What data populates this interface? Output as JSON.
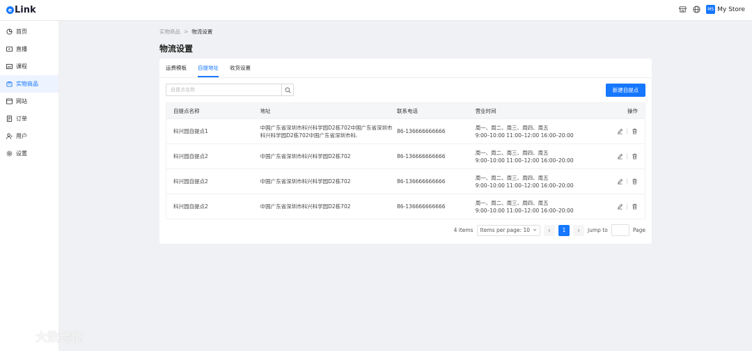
{
  "app": {
    "logo_text": "Link",
    "logo_mark": "e"
  },
  "header": {
    "store_badge": "MS",
    "store_name": "My Store",
    "icons": [
      "storefront-icon",
      "globe-icon"
    ]
  },
  "sidebar": {
    "items": [
      {
        "label": "首页",
        "icon": "dashboard-icon",
        "active": false
      },
      {
        "label": "直播",
        "icon": "live-icon",
        "active": false
      },
      {
        "label": "课程",
        "icon": "course-icon",
        "active": false
      },
      {
        "label": "实物商品",
        "icon": "product-icon",
        "active": true
      },
      {
        "label": "网站",
        "icon": "website-icon",
        "active": false
      },
      {
        "label": "订单",
        "icon": "order-icon",
        "active": false
      },
      {
        "label": "用户",
        "icon": "user-icon",
        "active": false
      },
      {
        "label": "设置",
        "icon": "settings-icon",
        "active": false
      }
    ]
  },
  "breadcrumb": {
    "parent": "实物商品",
    "separator": ">",
    "current": "物流设置"
  },
  "page": {
    "title": "物流设置"
  },
  "tabs": [
    {
      "label": "运费模板",
      "active": false
    },
    {
      "label": "自提地址",
      "active": true
    },
    {
      "label": "收货设置",
      "active": false
    }
  ],
  "search": {
    "placeholder": "自提点名称",
    "value": ""
  },
  "new_button": {
    "label": "新建自提点"
  },
  "table": {
    "headers": {
      "name": "自提点名称",
      "address": "地址",
      "phone": "联系电话",
      "hours": "营业时间",
      "ops": "操作"
    },
    "rows": [
      {
        "name": "科兴园自提点1",
        "address": "中国广东省深圳市科兴科学园D2栋702中国广东省深圳市科兴科学园D2栋702中国广东省深圳市科.",
        "phone": "86-136666666666",
        "days": "周一、周二、周三、周四、周五",
        "times": "9:00–10:00 11:00–12:00 16:00–20:00"
      },
      {
        "name": "科兴园自提点2",
        "address": "中国广东省深圳市科兴科学园D2栋702",
        "phone": "86-136666666666",
        "days": "周一、周二、周三、周四、周五",
        "times": "9:00–10:00 11:00–12:00 16:00–20:00"
      },
      {
        "name": "科兴园自提点2",
        "address": "中国广东省深圳市科兴科学园D2栋702",
        "phone": "86-136666666666",
        "days": "周一、周二、周三、周四、周五",
        "times": "9:00–10:00 11:00–12:00 16:00–20:00"
      },
      {
        "name": "科兴园自提点2",
        "address": "中国广东省深圳市科兴科学园D2栋702",
        "phone": "86-136666666666",
        "days": "周一、周二、周三、周四、周五",
        "times": "9:00–10:00 11:00–12:00 16:00–20:00"
      }
    ]
  },
  "pagination": {
    "total": "4 items",
    "per_page": "Items per page: 10",
    "current_page": "1",
    "jump_label": "jump to",
    "page_label": "Page"
  },
  "watermark": {
    "text": "大数跨境"
  },
  "colors": {
    "accent": "#1677ff",
    "sidebar_active_bg": "#eef4ff",
    "page_bg": "#f0f1f4"
  }
}
